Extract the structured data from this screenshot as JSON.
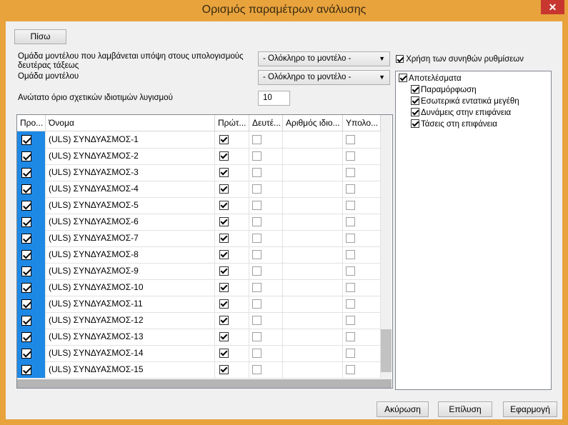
{
  "window": {
    "title": "Ορισμός παραμέτρων ανάλυσης",
    "close_glyph": "✕"
  },
  "back_label": "Πίσω",
  "fields": {
    "second_order_label": "Ομάδα μοντέλου που λαμβάνεται υπόψη στους υπολογισμούς δευτέρας τάξεως",
    "second_order_value": "- Ολόκληρο το μοντέλο -",
    "model_group_label": "Ομάδα μοντέλου",
    "model_group_value": "- Ολόκληρο το μοντέλο -",
    "eigenmodes_label": "Ανώτατο όριο σχετικών ιδιοτιμών λυγισμού",
    "eigenmodes_value": "10"
  },
  "use_defaults_label": "Χρήση των συνηθών ρυθμίσεων",
  "table": {
    "headers": [
      "Προ...",
      "Όνομα",
      "Πρώτ...",
      "Δευτέ...",
      "Αριθμός ιδιο...",
      "Υπολο..."
    ],
    "rows": [
      "(ULS) ΣΥΝΔΥΑΣΜΟΣ-1",
      "(ULS) ΣΥΝΔΥΑΣΜΟΣ-2",
      "(ULS) ΣΥΝΔΥΑΣΜΟΣ-3",
      "(ULS) ΣΥΝΔΥΑΣΜΟΣ-4",
      "(ULS) ΣΥΝΔΥΑΣΜΟΣ-5",
      "(ULS) ΣΥΝΔΥΑΣΜΟΣ-6",
      "(ULS) ΣΥΝΔΥΑΣΜΟΣ-7",
      "(ULS) ΣΥΝΔΥΑΣΜΟΣ-8",
      "(ULS) ΣΥΝΔΥΑΣΜΟΣ-9",
      "(ULS) ΣΥΝΔΥΑΣΜΟΣ-10",
      "(ULS) ΣΥΝΔΥΑΣΜΟΣ-11",
      "(ULS) ΣΥΝΔΥΑΣΜΟΣ-12",
      "(ULS) ΣΥΝΔΥΑΣΜΟΣ-13",
      "(ULS) ΣΥΝΔΥΑΣΜΟΣ-14",
      "(ULS) ΣΥΝΔΥΑΣΜΟΣ-15"
    ]
  },
  "tree": {
    "root": "Αποτελέσματα",
    "children": [
      "Παραμόρφωση",
      "Εσωτερικά εντατικά μεγέθη",
      "Δυνάμεις στην επιφάνεια",
      "Τάσεις στη επιφάνεια"
    ]
  },
  "buttons": {
    "cancel": "Ακύρωση",
    "solve": "Επίλυση",
    "apply": "Εφαρμογή"
  },
  "colors": {
    "titlebar": "#e8a33d",
    "selection": "#1e88e5",
    "close": "#c7372f"
  }
}
